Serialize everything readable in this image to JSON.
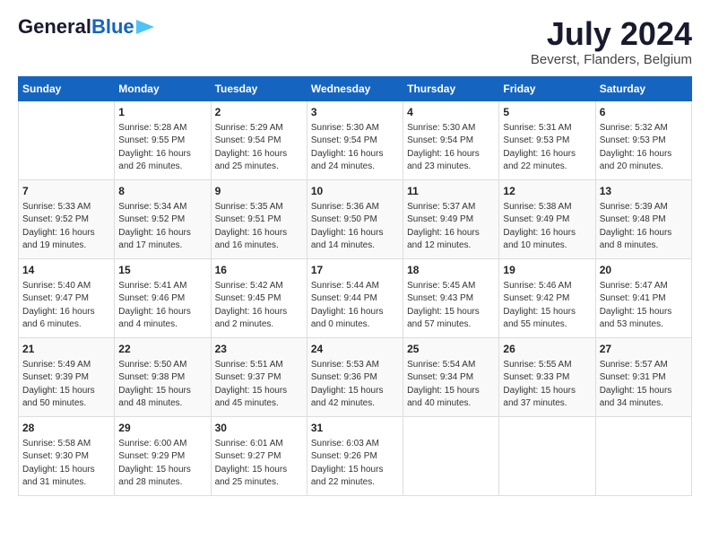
{
  "header": {
    "logo_general": "General",
    "logo_blue": "Blue",
    "month_title": "July 2024",
    "location": "Beverst, Flanders, Belgium"
  },
  "days_of_week": [
    "Sunday",
    "Monday",
    "Tuesday",
    "Wednesday",
    "Thursday",
    "Friday",
    "Saturday"
  ],
  "weeks": [
    [
      {
        "day": "",
        "text": ""
      },
      {
        "day": "1",
        "text": "Sunrise: 5:28 AM\nSunset: 9:55 PM\nDaylight: 16 hours\nand 26 minutes."
      },
      {
        "day": "2",
        "text": "Sunrise: 5:29 AM\nSunset: 9:54 PM\nDaylight: 16 hours\nand 25 minutes."
      },
      {
        "day": "3",
        "text": "Sunrise: 5:30 AM\nSunset: 9:54 PM\nDaylight: 16 hours\nand 24 minutes."
      },
      {
        "day": "4",
        "text": "Sunrise: 5:30 AM\nSunset: 9:54 PM\nDaylight: 16 hours\nand 23 minutes."
      },
      {
        "day": "5",
        "text": "Sunrise: 5:31 AM\nSunset: 9:53 PM\nDaylight: 16 hours\nand 22 minutes."
      },
      {
        "day": "6",
        "text": "Sunrise: 5:32 AM\nSunset: 9:53 PM\nDaylight: 16 hours\nand 20 minutes."
      }
    ],
    [
      {
        "day": "7",
        "text": "Sunrise: 5:33 AM\nSunset: 9:52 PM\nDaylight: 16 hours\nand 19 minutes."
      },
      {
        "day": "8",
        "text": "Sunrise: 5:34 AM\nSunset: 9:52 PM\nDaylight: 16 hours\nand 17 minutes."
      },
      {
        "day": "9",
        "text": "Sunrise: 5:35 AM\nSunset: 9:51 PM\nDaylight: 16 hours\nand 16 minutes."
      },
      {
        "day": "10",
        "text": "Sunrise: 5:36 AM\nSunset: 9:50 PM\nDaylight: 16 hours\nand 14 minutes."
      },
      {
        "day": "11",
        "text": "Sunrise: 5:37 AM\nSunset: 9:49 PM\nDaylight: 16 hours\nand 12 minutes."
      },
      {
        "day": "12",
        "text": "Sunrise: 5:38 AM\nSunset: 9:49 PM\nDaylight: 16 hours\nand 10 minutes."
      },
      {
        "day": "13",
        "text": "Sunrise: 5:39 AM\nSunset: 9:48 PM\nDaylight: 16 hours\nand 8 minutes."
      }
    ],
    [
      {
        "day": "14",
        "text": "Sunrise: 5:40 AM\nSunset: 9:47 PM\nDaylight: 16 hours\nand 6 minutes."
      },
      {
        "day": "15",
        "text": "Sunrise: 5:41 AM\nSunset: 9:46 PM\nDaylight: 16 hours\nand 4 minutes."
      },
      {
        "day": "16",
        "text": "Sunrise: 5:42 AM\nSunset: 9:45 PM\nDaylight: 16 hours\nand 2 minutes."
      },
      {
        "day": "17",
        "text": "Sunrise: 5:44 AM\nSunset: 9:44 PM\nDaylight: 16 hours\nand 0 minutes."
      },
      {
        "day": "18",
        "text": "Sunrise: 5:45 AM\nSunset: 9:43 PM\nDaylight: 15 hours\nand 57 minutes."
      },
      {
        "day": "19",
        "text": "Sunrise: 5:46 AM\nSunset: 9:42 PM\nDaylight: 15 hours\nand 55 minutes."
      },
      {
        "day": "20",
        "text": "Sunrise: 5:47 AM\nSunset: 9:41 PM\nDaylight: 15 hours\nand 53 minutes."
      }
    ],
    [
      {
        "day": "21",
        "text": "Sunrise: 5:49 AM\nSunset: 9:39 PM\nDaylight: 15 hours\nand 50 minutes."
      },
      {
        "day": "22",
        "text": "Sunrise: 5:50 AM\nSunset: 9:38 PM\nDaylight: 15 hours\nand 48 minutes."
      },
      {
        "day": "23",
        "text": "Sunrise: 5:51 AM\nSunset: 9:37 PM\nDaylight: 15 hours\nand 45 minutes."
      },
      {
        "day": "24",
        "text": "Sunrise: 5:53 AM\nSunset: 9:36 PM\nDaylight: 15 hours\nand 42 minutes."
      },
      {
        "day": "25",
        "text": "Sunrise: 5:54 AM\nSunset: 9:34 PM\nDaylight: 15 hours\nand 40 minutes."
      },
      {
        "day": "26",
        "text": "Sunrise: 5:55 AM\nSunset: 9:33 PM\nDaylight: 15 hours\nand 37 minutes."
      },
      {
        "day": "27",
        "text": "Sunrise: 5:57 AM\nSunset: 9:31 PM\nDaylight: 15 hours\nand 34 minutes."
      }
    ],
    [
      {
        "day": "28",
        "text": "Sunrise: 5:58 AM\nSunset: 9:30 PM\nDaylight: 15 hours\nand 31 minutes."
      },
      {
        "day": "29",
        "text": "Sunrise: 6:00 AM\nSunset: 9:29 PM\nDaylight: 15 hours\nand 28 minutes."
      },
      {
        "day": "30",
        "text": "Sunrise: 6:01 AM\nSunset: 9:27 PM\nDaylight: 15 hours\nand 25 minutes."
      },
      {
        "day": "31",
        "text": "Sunrise: 6:03 AM\nSunset: 9:26 PM\nDaylight: 15 hours\nand 22 minutes."
      },
      {
        "day": "",
        "text": ""
      },
      {
        "day": "",
        "text": ""
      },
      {
        "day": "",
        "text": ""
      }
    ]
  ]
}
